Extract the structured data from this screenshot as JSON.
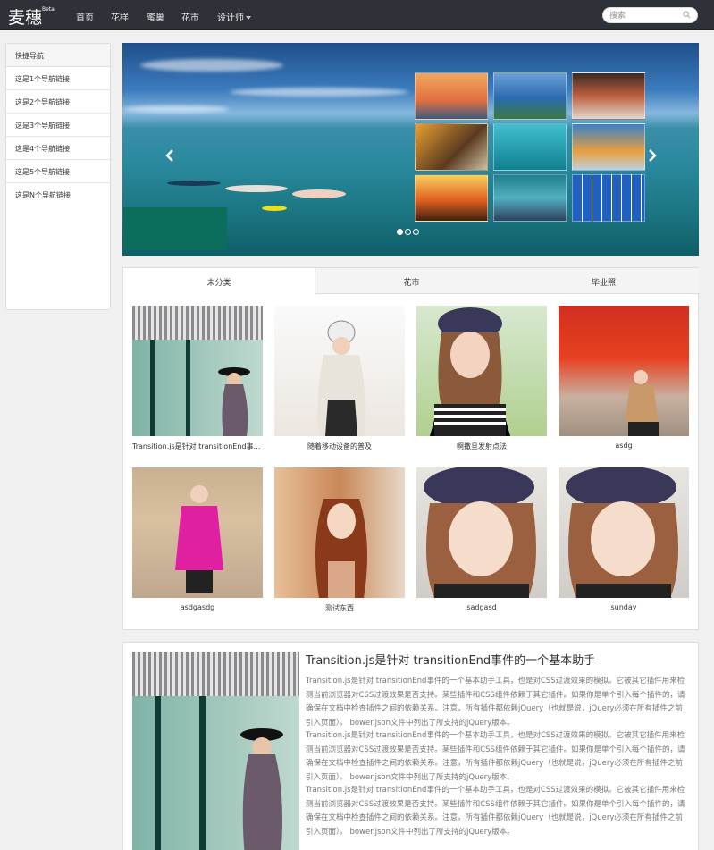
{
  "navbar": {
    "brand": "麦穗",
    "brand_badge": "Beta",
    "items": [
      "首页",
      "花样",
      "蜜巢",
      "花市",
      "设计师"
    ],
    "search_placeholder": "搜索"
  },
  "sidebar": {
    "title": "快捷导航",
    "items": [
      "这是1个导航链接",
      "这是2个导航链接",
      "这是3个导航链接",
      "这是4个导航链接",
      "这是5个导航链接",
      "这是N个导航链接"
    ]
  },
  "carousel": {
    "dot_count": 3,
    "active_dot": 0
  },
  "gallery": {
    "tabs": [
      "未分类",
      "花市",
      "毕业照"
    ],
    "active_tab": 0,
    "items": [
      {
        "caption": "Transition.js是针对 transitionEnd事件的一个基本助手",
        "image": "woman-storefront"
      },
      {
        "caption": "随着移动设备的普及",
        "image": "woman-beanie"
      },
      {
        "caption": "啊撒旦发射点法",
        "image": "woman-beret"
      },
      {
        "caption": "asdg",
        "image": "woman-red-leaves"
      },
      {
        "caption": "asdgasdg",
        "image": "woman-pink-coat"
      },
      {
        "caption": "测试东西",
        "image": "woman-cafe"
      },
      {
        "caption": "sadgasd",
        "image": "woman-beret-closeup"
      },
      {
        "caption": "sunday",
        "image": "woman-beret-closeup"
      }
    ]
  },
  "article": {
    "title": "Transition.js是针对 transitionEnd事件的一个基本助手",
    "paragraphs": [
      "Transition.js是针对 transitionEnd事件的一个基本助手工具，也是对CSS过渡效果的模拟。它被其它插件用来检测当前浏览器对CSS过渡效果是否支持。某些插件和CSS组件依赖于其它插件。如果你是单个引入每个插件的，请确保在文档中检查插件之间的依赖关系。注意，所有插件都依赖jQuery（也就是说，jQuery必须在所有插件之前引入页面）。 bower.json文件中列出了所支持的jQuery版本。",
      "Transition.js是针对 transitionEnd事件的一个基本助手工具，也是对CSS过渡效果的模拟。它被其它插件用来检测当前浏览器对CSS过渡效果是否支持。某些插件和CSS组件依赖于其它插件。如果你是单个引入每个插件的，请确保在文档中检查插件之间的依赖关系。注意，所有插件都依赖jQuery（也就是说，jQuery必须在所有插件之前引入页面）。 bower.json文件中列出了所支持的jQuery版本。",
      "Transition.js是针对 transitionEnd事件的一个基本助手工具，也是对CSS过渡效果的模拟。它被其它插件用来检测当前浏览器对CSS过渡效果是否支持。某些插件和CSS组件依赖于其它插件。如果你是单个引入每个插件的，请确保在文档中检查插件之间的依赖关系。注意，所有插件都依赖jQuery（也就是说，jQuery必须在所有插件之前引入页面）。 bower.json文件中列出了所支持的jQuery版本。"
    ]
  },
  "colors": {
    "navbar_bg": "#2e3238",
    "carousel_caption_bg": "#0b6e5c",
    "page_bg": "#f0f0f0"
  }
}
